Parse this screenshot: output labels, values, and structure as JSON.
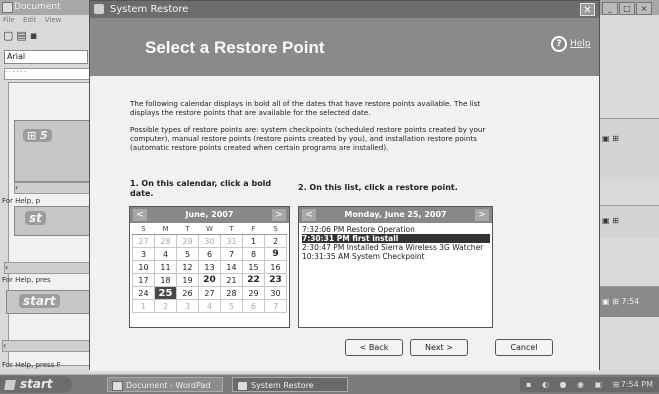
{
  "background": {
    "title": "Document",
    "menu": [
      "File",
      "Edit",
      "View"
    ],
    "font_box": "Arial",
    "help_text": "For Help, p",
    "help_text_2": "For Help, pres",
    "help_text_3": "For Help, press F",
    "start_label": "start",
    "start_label_partial": "st",
    "tray_time": "7:54"
  },
  "taskbar": {
    "start": "start",
    "items": [
      {
        "label": "Document - WordPad"
      },
      {
        "label": "System Restore"
      }
    ],
    "clock": "7:54 PM"
  },
  "dialog": {
    "title": "System Restore",
    "header": "Select a Restore Point",
    "help": "Help",
    "intro": "The following calendar displays in bold all of the dates that have restore points available. The list displays the restore points that are available for the selected date.",
    "types": "Possible types of restore points are: system checkpoints (scheduled restore points created by your computer), manual restore points (restore points created by you), and installation restore points (automatic restore points created when certain programs are installed).",
    "step1": "1. On this calendar, click a bold date.",
    "step2": "2. On this list, click a restore point.",
    "calendar": {
      "month": "June, 2007",
      "prev": "<",
      "next": ">",
      "days": [
        "S",
        "M",
        "T",
        "W",
        "T",
        "F",
        "S"
      ],
      "weeks": [
        [
          "27",
          "28",
          "29",
          "30",
          "31",
          "1",
          "2"
        ],
        [
          "3",
          "4",
          "5",
          "6",
          "7",
          "8",
          "9"
        ],
        [
          "10",
          "11",
          "12",
          "13",
          "14",
          "15",
          "16"
        ],
        [
          "17",
          "18",
          "19",
          "20",
          "21",
          "22",
          "23"
        ],
        [
          "24",
          "25",
          "26",
          "27",
          "28",
          "29",
          "30"
        ],
        [
          "1",
          "2",
          "3",
          "4",
          "5",
          "6",
          "7"
        ]
      ],
      "selected": "25"
    },
    "list": {
      "date": "Monday, June 25, 2007",
      "prev": "<",
      "next": ">",
      "items": [
        "7:32:06 PM  Restore Operation",
        "7:30:31 PM  first install",
        "2:30:47 PM  Installed Sierra Wireless 3G Watcher",
        "10:31:35 AM  System Checkpoint"
      ],
      "selected_index": 1
    },
    "buttons": {
      "back": "< Back",
      "next": "Next >",
      "cancel": "Cancel"
    }
  }
}
